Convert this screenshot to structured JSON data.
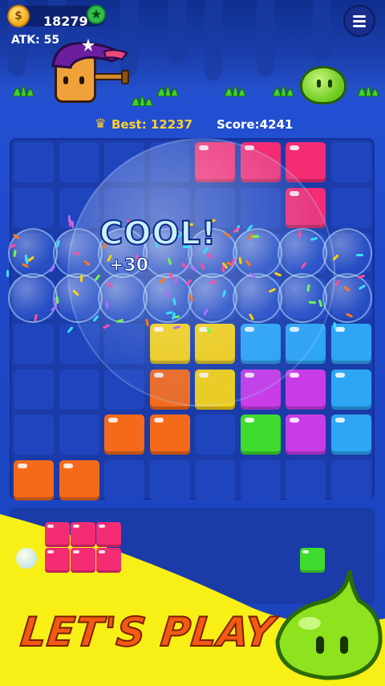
{
  "currency": {
    "coins": "18279",
    "icon": "coin-icon",
    "add_icon": "star-plus-icon"
  },
  "stats": {
    "attack": "ATK: 55"
  },
  "menu": {
    "icon": "hamburger-menu-icon"
  },
  "scores": {
    "best": "Best: 12237",
    "score": "Score:4241",
    "best_icon": "crown-icon"
  },
  "effects": {
    "combo_text": "COOL!",
    "bonus_text": "+30"
  },
  "banner": {
    "text": "LET'S PLAY !!"
  },
  "colors": {
    "pink": "#f42c74",
    "yellow": "#f7d113",
    "orange": "#f56a1a",
    "cyan": "#2fa6f5",
    "magenta": "#c93de8",
    "green": "#3fdb2f",
    "board": "#1a3ba8",
    "banner_yellow": "#f8ef16"
  },
  "board": {
    "rows": 8,
    "cols": 8,
    "cells": [
      [
        "",
        "",
        "",
        "",
        "pink",
        "pink",
        "pink",
        ""
      ],
      [
        "",
        "",
        "",
        "",
        "",
        "",
        "pink",
        ""
      ],
      [
        "",
        "",
        "",
        "",
        "",
        "",
        "",
        ""
      ],
      [
        "",
        "",
        "",
        "",
        "",
        "",
        "",
        ""
      ],
      [
        "",
        "",
        "",
        "yellow",
        "yellow",
        "cyan",
        "cyan",
        "cyan"
      ],
      [
        "",
        "",
        "",
        "orange",
        "yellow",
        "magenta",
        "magenta",
        "cyan"
      ],
      [
        "",
        "",
        "orange",
        "orange",
        "",
        "green",
        "magenta",
        "cyan"
      ],
      [
        "orange",
        "orange",
        "",
        "",
        "",
        "",
        "",
        ""
      ]
    ]
  },
  "tray": {
    "pieces": [
      {
        "color": "pink",
        "cells": [
          [
            0,
            0
          ],
          [
            1,
            0
          ],
          [
            2,
            0
          ],
          [
            0,
            1
          ],
          [
            1,
            1
          ],
          [
            2,
            1
          ]
        ]
      },
      {
        "color": "green",
        "cells": [
          [
            0,
            0
          ]
        ]
      }
    ]
  }
}
